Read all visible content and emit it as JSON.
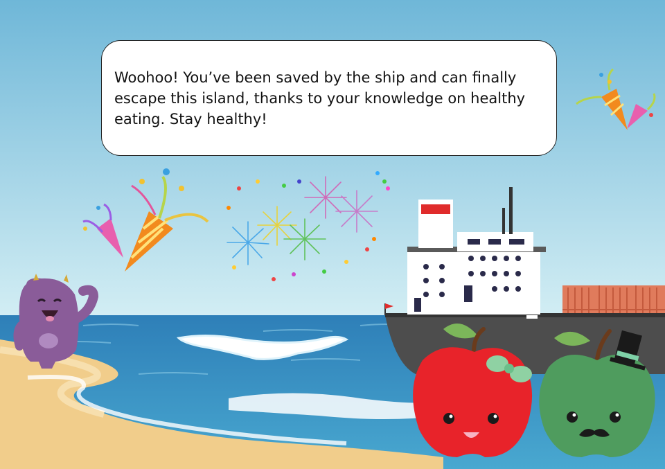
{
  "dialog": {
    "message": "Woohoo! You’ve been saved by the ship and can finally escape this island, thanks to your knowledge on healthy eating. Stay healthy!"
  },
  "colors": {
    "sky": "#79bcd9",
    "sea": "#3b8cc0",
    "sand": "#f1cd8b",
    "monster": "#8a5c99",
    "red_apple": "#e8232a",
    "green_apple": "#4f9c5e",
    "ship_hull": "#4d4d4d",
    "containers": "#e07b5c"
  },
  "characters": [
    "purple-monster",
    "red-apple-with-bow",
    "green-apple-with-top-hat"
  ],
  "decorations": [
    "party-popper-icon",
    "fireworks",
    "ship"
  ]
}
